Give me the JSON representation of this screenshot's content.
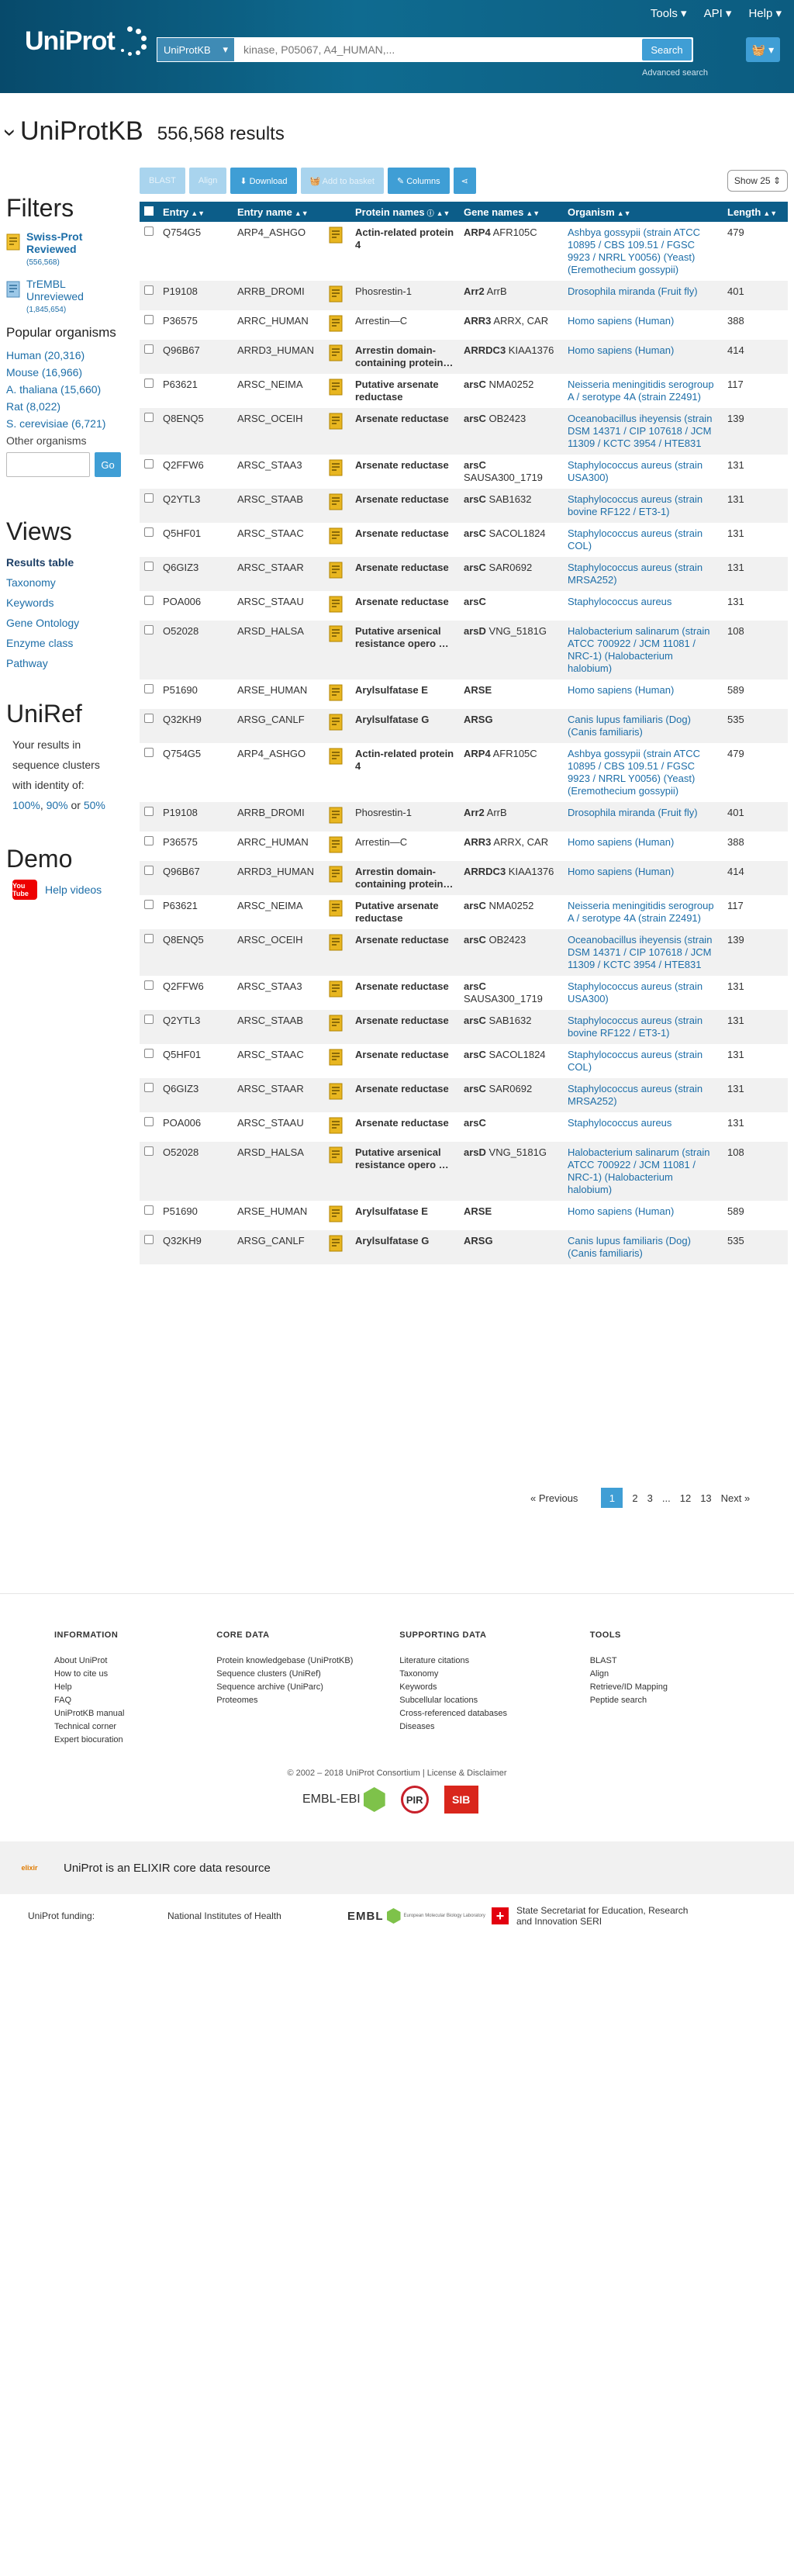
{
  "header": {
    "logo_text": "UniProt",
    "nav": [
      "Tools ▾",
      "API ▾",
      "Help ▾"
    ],
    "search_db": "UniProtKB",
    "search_placeholder": "kinase, P05067, A4_HUMAN,...",
    "search_button": "Search",
    "advanced": "Advanced search",
    "basket": "🧺 ▾"
  },
  "page": {
    "title": "UniProtKB",
    "count": "556,568 results"
  },
  "sidebar": {
    "filters": "Filters",
    "reviewed_label1": "Swiss-Prot",
    "reviewed_label2": "Reviewed",
    "reviewed_count": "(556,568)",
    "unreviewed_label1": "TrEMBL",
    "unreviewed_label2": "Unreviewed",
    "unreviewed_count": "(1,845,654)",
    "popular": "Popular organisms",
    "organisms": [
      "Human (20,316)",
      "Mouse (16,966)",
      "A. thaliana (15,660)",
      "Rat (8,022)",
      "S. cerevisiae (6,721)"
    ],
    "other": "Other organisms",
    "go": "Go",
    "views": "Views",
    "view_items": [
      "Results table",
      "Taxonomy",
      "Keywords",
      "Gene Ontology",
      "Enzyme class",
      "Pathway"
    ],
    "uniref": "UniRef",
    "uniref_line1": "Your results in",
    "uniref_line2": "sequence clusters",
    "uniref_line3": "with identity of:",
    "uniref_100": "100%",
    "uniref_90": "90%",
    "uniref_or": "or",
    "uniref_50": "50%",
    "demo": "Demo",
    "yt": "You Tube",
    "help_videos": "Help videos"
  },
  "toolbar": {
    "blast": "BLAST",
    "align": "Align",
    "download": "⬇ Download",
    "add_basket": "🧺 Add to basket",
    "columns": "✎ Columns",
    "share": "⋖",
    "show": "Show 25 ⇕"
  },
  "columns": [
    "Entry",
    "Entry name",
    "Protein names",
    "Gene names",
    "Organism",
    "Length"
  ],
  "rows": [
    {
      "entry": "Q754G5",
      "name": "ARP4_ASHGO",
      "protein": "Actin-related protein 4",
      "bold": true,
      "gene_b": "ARP4",
      "gene": "AFR105C",
      "organism": "Ashbya gossypii (strain ATCC 10895 / CBS 109.51 / FGSC 9923 / NRRL Y0056) (Yeast) (Eremothecium gossypii)",
      "length": "479"
    },
    {
      "entry": "P19108",
      "name": "ARRB_DROMI",
      "protein": "Phosrestin-1",
      "bold": false,
      "gene_b": "Arr2",
      "gene": "ArrB",
      "organism": "Drosophila miranda (Fruit fly)",
      "length": "401"
    },
    {
      "entry": "P36575",
      "name": "ARRC_HUMAN",
      "protein": "Arrestin—C",
      "bold": false,
      "gene_b": "ARR3",
      "gene": "ARRX, CAR",
      "organism": "Homo sapiens (Human)",
      "length": "388"
    },
    {
      "entry": "Q96B67",
      "name": "ARRD3_HUMAN",
      "protein": "Arrestin domain-containing protein…",
      "bold": true,
      "gene_b": "ARRDC3",
      "gene": "KIAA1376",
      "organism": "Homo sapiens (Human)",
      "length": "414"
    },
    {
      "entry": "P63621",
      "name": "ARSC_NEIMA",
      "protein": "Putative arsenate reductase",
      "bold": true,
      "gene_b": "arsC",
      "gene": "NMA0252",
      "organism": "Neisseria meningitidis serogroup A / serotype 4A (strain Z2491)",
      "length": "117"
    },
    {
      "entry": "Q8ENQ5",
      "name": "ARSC_OCEIH",
      "protein": "Arsenate reductase",
      "bold": true,
      "gene_b": "arsC",
      "gene": "OB2423",
      "organism": "Oceanobacillus iheyensis (strain DSM 14371 / CIP 107618 / JCM 11309 / KCTC 3954 / HTE831",
      "length": "139"
    },
    {
      "entry": "Q2FFW6",
      "name": "ARSC_STAA3",
      "protein": "Arsenate reductase",
      "bold": true,
      "gene_b": "arsC",
      "gene": "SAUSA300_1719",
      "organism": "Staphylococcus aureus (strain USA300)",
      "length": "131"
    },
    {
      "entry": "Q2YTL3",
      "name": "ARSC_STAAB",
      "protein": "Arsenate reductase",
      "bold": true,
      "gene_b": "arsC",
      "gene": "SAB1632",
      "organism": "Staphylococcus aureus (strain bovine RF122 / ET3-1)",
      "length": "131"
    },
    {
      "entry": "Q5HF01",
      "name": "ARSC_STAAC",
      "protein": "Arsenate reductase",
      "bold": true,
      "gene_b": "arsC",
      "gene": "SACOL1824",
      "organism": "Staphylococcus aureus (strain COL)",
      "length": "131"
    },
    {
      "entry": "Q6GIZ3",
      "name": "ARSC_STAAR",
      "protein": "Arsenate reductase",
      "bold": true,
      "gene_b": "arsC",
      "gene": "SAR0692",
      "organism": "Staphylococcus aureus (strain MRSA252)",
      "length": "131"
    },
    {
      "entry": "POA006",
      "name": "ARSC_STAAU",
      "protein": "Arsenate reductase",
      "bold": true,
      "gene_b": "arsC",
      "gene": "",
      "organism": "Staphylococcus aureus",
      "length": "131"
    },
    {
      "entry": "O52028",
      "name": "ARSD_HALSA",
      "protein": "Putative arsenical resistance opero …",
      "bold": true,
      "gene_b": "arsD",
      "gene": "VNG_5181G",
      "organism": "Halobacterium salinarum (strain ATCC 700922 / JCM 11081 / NRC-1) (Halobacterium halobium)",
      "length": "108"
    },
    {
      "entry": "P51690",
      "name": "ARSE_HUMAN",
      "protein": "Arylsulfatase E",
      "bold": true,
      "gene_b": "ARSE",
      "gene": "",
      "organism": "Homo sapiens (Human)",
      "length": "589"
    },
    {
      "entry": "Q32KH9",
      "name": "ARSG_CANLF",
      "protein": "Arylsulfatase G",
      "bold": true,
      "gene_b": "ARSG",
      "gene": "",
      "organism": "Canis lupus familiaris (Dog) (Canis familiaris)",
      "length": "535"
    },
    {
      "entry": "Q754G5",
      "name": "ARP4_ASHGO",
      "protein": "Actin-related protein 4",
      "bold": true,
      "gene_b": "ARP4",
      "gene": "AFR105C",
      "organism": "Ashbya gossypii (strain ATCC 10895 / CBS 109.51 / FGSC 9923 / NRRL Y0056) (Yeast) (Eremothecium gossypii)",
      "length": "479"
    },
    {
      "entry": "P19108",
      "name": "ARRB_DROMI",
      "protein": "Phosrestin-1",
      "bold": false,
      "gene_b": "Arr2",
      "gene": "ArrB",
      "organism": "Drosophila miranda (Fruit fly)",
      "length": "401"
    },
    {
      "entry": "P36575",
      "name": "ARRC_HUMAN",
      "protein": "Arrestin—C",
      "bold": false,
      "gene_b": "ARR3",
      "gene": "ARRX, CAR",
      "organism": "Homo sapiens (Human)",
      "length": "388"
    },
    {
      "entry": "Q96B67",
      "name": "ARRD3_HUMAN",
      "protein": "Arrestin domain-containing protein…",
      "bold": true,
      "gene_b": "ARRDC3",
      "gene": "KIAA1376",
      "organism": "Homo sapiens (Human)",
      "length": "414"
    },
    {
      "entry": "P63621",
      "name": "ARSC_NEIMA",
      "protein": "Putative arsenate reductase",
      "bold": true,
      "gene_b": "arsC",
      "gene": "NMA0252",
      "organism": "Neisseria meningitidis serogroup A / serotype 4A (strain Z2491)",
      "length": "117"
    },
    {
      "entry": "Q8ENQ5",
      "name": "ARSC_OCEIH",
      "protein": "Arsenate reductase",
      "bold": true,
      "gene_b": "arsC",
      "gene": "OB2423",
      "organism": "Oceanobacillus iheyensis (strain DSM 14371 / CIP 107618 / JCM 11309 / KCTC 3954 / HTE831",
      "length": "139"
    },
    {
      "entry": "Q2FFW6",
      "name": "ARSC_STAA3",
      "protein": "Arsenate reductase",
      "bold": true,
      "gene_b": "arsC",
      "gene": "SAUSA300_1719",
      "organism": "Staphylococcus aureus (strain USA300)",
      "length": "131"
    },
    {
      "entry": "Q2YTL3",
      "name": "ARSC_STAAB",
      "protein": "Arsenate reductase",
      "bold": true,
      "gene_b": "arsC",
      "gene": "SAB1632",
      "organism": "Staphylococcus aureus (strain bovine RF122 / ET3-1)",
      "length": "131"
    },
    {
      "entry": "Q5HF01",
      "name": "ARSC_STAAC",
      "protein": "Arsenate reductase",
      "bold": true,
      "gene_b": "arsC",
      "gene": "SACOL1824",
      "organism": "Staphylococcus aureus (strain COL)",
      "length": "131"
    },
    {
      "entry": "Q6GIZ3",
      "name": "ARSC_STAAR",
      "protein": "Arsenate reductase",
      "bold": true,
      "gene_b": "arsC",
      "gene": "SAR0692",
      "organism": "Staphylococcus aureus (strain MRSA252)",
      "length": "131"
    },
    {
      "entry": "POA006",
      "name": "ARSC_STAAU",
      "protein": "Arsenate reductase",
      "bold": true,
      "gene_b": "arsC",
      "gene": "",
      "organism": "Staphylococcus aureus",
      "length": "131"
    },
    {
      "entry": "O52028",
      "name": "ARSD_HALSA",
      "protein": "Putative arsenical resistance opero …",
      "bold": true,
      "gene_b": "arsD",
      "gene": "VNG_5181G",
      "organism": "Halobacterium salinarum (strain ATCC 700922 / JCM 11081 / NRC-1) (Halobacterium halobium)",
      "length": "108"
    },
    {
      "entry": "P51690",
      "name": "ARSE_HUMAN",
      "protein": "Arylsulfatase E",
      "bold": true,
      "gene_b": "ARSE",
      "gene": "",
      "organism": "Homo sapiens (Human)",
      "length": "589"
    },
    {
      "entry": "Q32KH9",
      "name": "ARSG_CANLF",
      "protein": "Arylsulfatase G",
      "bold": true,
      "gene_b": "ARSG",
      "gene": "",
      "organism": "Canis lupus familiaris (Dog) (Canis familiaris)",
      "length": "535"
    }
  ],
  "pagination": {
    "prev": "« Previous",
    "pages": [
      "1",
      "2",
      "3",
      "...",
      "12",
      "13"
    ],
    "next": "Next »"
  },
  "footer": {
    "cols": [
      {
        "h": "INFORMATION",
        "items": [
          "About UniProt",
          "How to cite us",
          "Help",
          "FAQ",
          "UniProtKB manual",
          "Technical corner",
          "Expert biocuration"
        ]
      },
      {
        "h": "CORE DATA",
        "items": [
          "Protein knowledgebase (UniProtKB)",
          "Sequence clusters (UniRef)",
          "Sequence archive (UniParc)",
          "Proteomes"
        ]
      },
      {
        "h": "SUPPORTING DATA",
        "items": [
          "Literature citations",
          "Taxonomy",
          "Keywords",
          "Subcellular locations",
          "Cross-referenced databases",
          "Diseases"
        ]
      },
      {
        "h": "TOOLS",
        "items": [
          "BLAST",
          "Align",
          "Retrieve/ID Mapping",
          "Peptide search"
        ]
      }
    ],
    "copyright": "© 2002 – 2018 UniProt Consortium | License & Disclaimer",
    "embl_ebi": "EMBL-EBI",
    "pir": "PIR",
    "sib": "SIB",
    "elixir_logo": "elixir",
    "elixir_text": "UniProt is an ELIXIR core data resource",
    "funding_label": "UniProt funding:",
    "nih": "National Institutes of Health",
    "embl": "EMBL",
    "embl_sub": "European Molecular Biology Laboratory",
    "swiss": "State Secretariat for Education, Research and Innovation SERI"
  }
}
